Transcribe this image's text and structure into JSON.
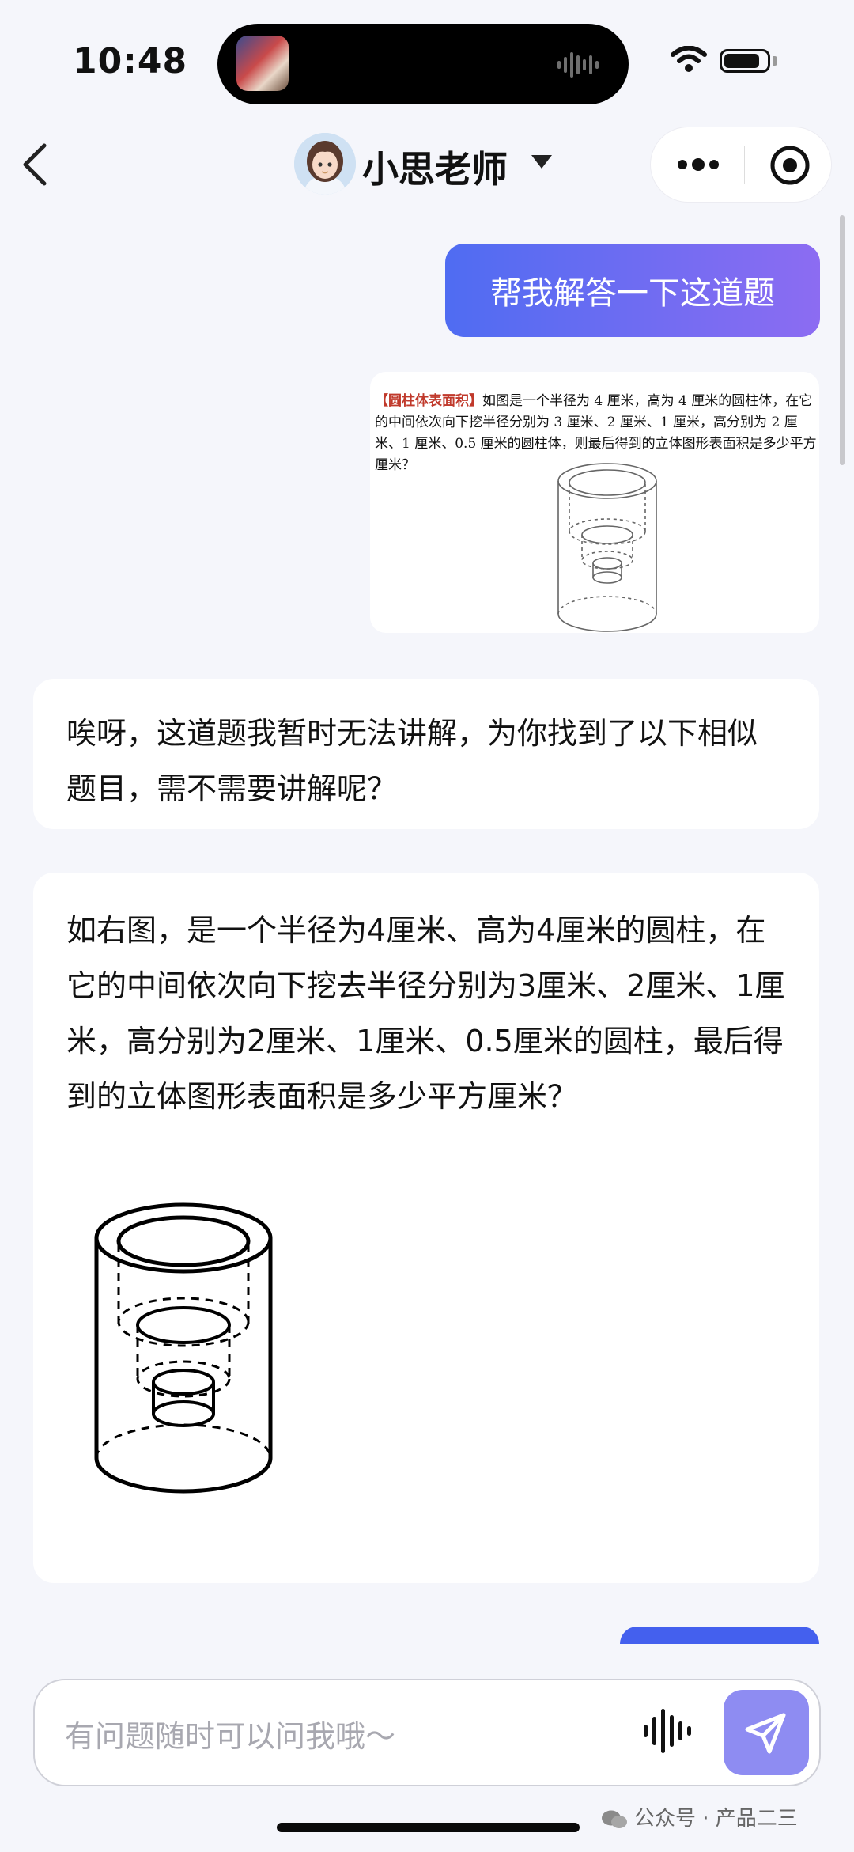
{
  "status_bar": {
    "time": "10:48"
  },
  "nav": {
    "title": "小思老师",
    "back_icon": "chevron-left-icon",
    "more_icon": "more-dots-icon",
    "close_icon": "target-icon"
  },
  "messages": {
    "user_text": "帮我解答一下这道题",
    "question_image": {
      "tag": "【圆柱体表面积】",
      "text": "如图是一个半径为 4 厘米，高为 4 厘米的圆柱体，在它的中间依次向下挖半径分别为 3 厘米、2 厘米、1 厘米，高分别为 2 厘米、1 厘米、0.5 厘米的圆柱体，则最后得到的立体图形表面积是多少平方厘米？"
    },
    "bot_reply": "唉呀，这道题我暂时无法讲解，为你找到了以下相似题目，需不需要讲解呢？",
    "similar_question": "如右图，是一个半径为4厘米、高为4厘米的圆柱，在它的中间依次向下挖去半径分别为3厘米、2厘米、1厘米，高分别为2厘米、1厘米、0.5厘米的圆柱，最后得到的立体图形表面积是多少平方厘米？"
  },
  "input": {
    "placeholder": "有问题随时可以问我哦～",
    "voice_icon": "voice-wave-icon",
    "send_icon": "send-icon"
  },
  "watermark": "公众号 · 产品二三",
  "colors": {
    "accent_gradient_start": "#4f6cf2",
    "accent_gradient_end": "#8c6cf2",
    "send_button": "#8e8cf2",
    "background": "#f5f6fb"
  }
}
